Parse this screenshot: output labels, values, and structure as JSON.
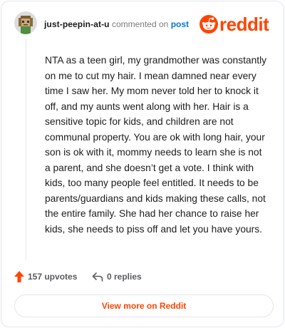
{
  "comment": {
    "username": "just-peepin-at-u",
    "action_text": "commented on",
    "post_link_text": "post",
    "body": "NTA as a teen girl, my grandmother was constantly on me to cut my hair. I mean damned near every time I saw her. My mom never told her to knock it off, and my aunts went along with her. Hair is a sensitive topic for kids, and children are not communal property. You are ok with long hair, your son is ok with it, mommy needs to learn she is not a parent, and she doesn’t get a vote. I think with kids, too many people feel entitled. It needs to be parents/guardians and kids making these calls, not the entire family. She had her chance to raise her kids, she needs to piss off and let you have yours."
  },
  "brand": {
    "wordmark": "reddit",
    "color": "#ff4500"
  },
  "actions": {
    "upvotes_label": "157 upvotes",
    "replies_label": "0 replies"
  },
  "footer": {
    "view_more_label": "View more on Reddit"
  },
  "icons": {
    "avatar": "avatar",
    "logo": "reddit-snoo-icon",
    "upvote": "upvote-arrow-icon",
    "reply": "reply-arrow-icon"
  },
  "colors": {
    "accent": "#ff4500",
    "link": "#0079d3",
    "muted": "#7c7c7c"
  }
}
